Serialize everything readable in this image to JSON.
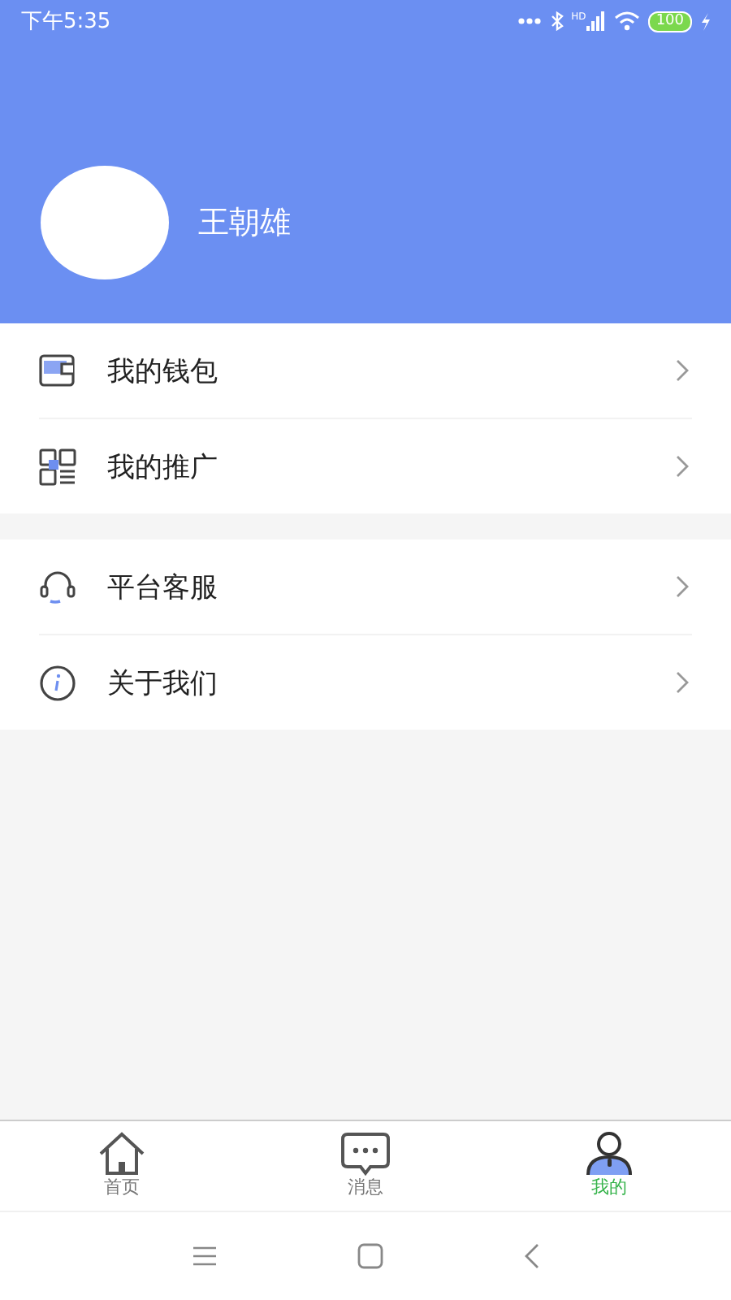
{
  "status_bar": {
    "time": "下午5:35",
    "network": "HD",
    "battery": "100"
  },
  "profile": {
    "name": "王朝雄"
  },
  "menu_groups": [
    {
      "items": [
        {
          "label": "我的钱包"
        },
        {
          "label": "我的推广"
        }
      ]
    },
    {
      "items": [
        {
          "label": "平台客服"
        },
        {
          "label": "关于我们"
        }
      ]
    }
  ],
  "tabs": [
    {
      "label": "首页",
      "selected": false
    },
    {
      "label": "消息",
      "selected": false
    },
    {
      "label": "我的",
      "selected": true
    }
  ]
}
